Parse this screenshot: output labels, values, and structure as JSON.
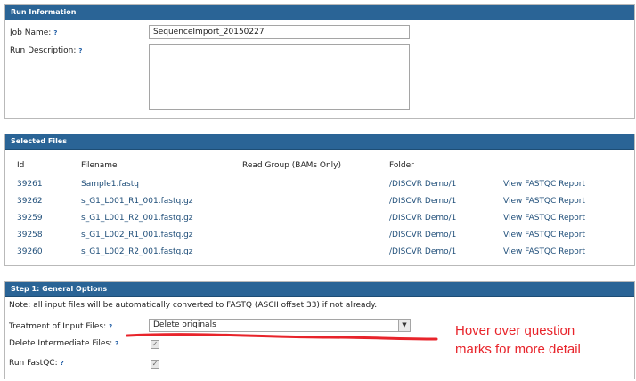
{
  "run_info": {
    "header": "Run Information",
    "job_name_label": "Job Name:",
    "job_name_value": "SequenceImport_20150227",
    "run_description_label": "Run Description:",
    "help_mark": "?"
  },
  "selected_files": {
    "header": "Selected Files",
    "columns": [
      "Id",
      "Filename",
      "Read Group (BAMs Only)",
      "Folder"
    ],
    "rows": [
      {
        "id": "39261",
        "filename": "Sample1.fastq",
        "folder": "/DISCVR Demo/1",
        "report": "View FASTQC Report"
      },
      {
        "id": "39262",
        "filename": "s_G1_L001_R1_001.fastq.gz",
        "folder": "/DISCVR Demo/1",
        "report": "View FASTQC Report"
      },
      {
        "id": "39259",
        "filename": "s_G1_L001_R2_001.fastq.gz",
        "folder": "/DISCVR Demo/1",
        "report": "View FASTQC Report"
      },
      {
        "id": "39258",
        "filename": "s_G1_L002_R1_001.fastq.gz",
        "folder": "/DISCVR Demo/1",
        "report": "View FASTQC Report"
      },
      {
        "id": "39260",
        "filename": "s_G1_L002_R2_001.fastq.gz",
        "folder": "/DISCVR Demo/1",
        "report": "View FASTQC Report"
      }
    ]
  },
  "general_options": {
    "header": "Step 1: General Options",
    "note": "Note: all input files will be automatically converted to FASTQ (ASCII offset 33) if not already.",
    "treatment_label": "Treatment of Input Files:",
    "treatment_value": "Delete originals",
    "delete_intermediate_label": "Delete Intermediate Files:",
    "delete_intermediate_checked": true,
    "run_fastqc_label": "Run FastQC:",
    "run_fastqc_checked": true
  },
  "annotation": {
    "line1": "Hover over question",
    "line2": "marks for more detail",
    "color": "#e8242b"
  }
}
